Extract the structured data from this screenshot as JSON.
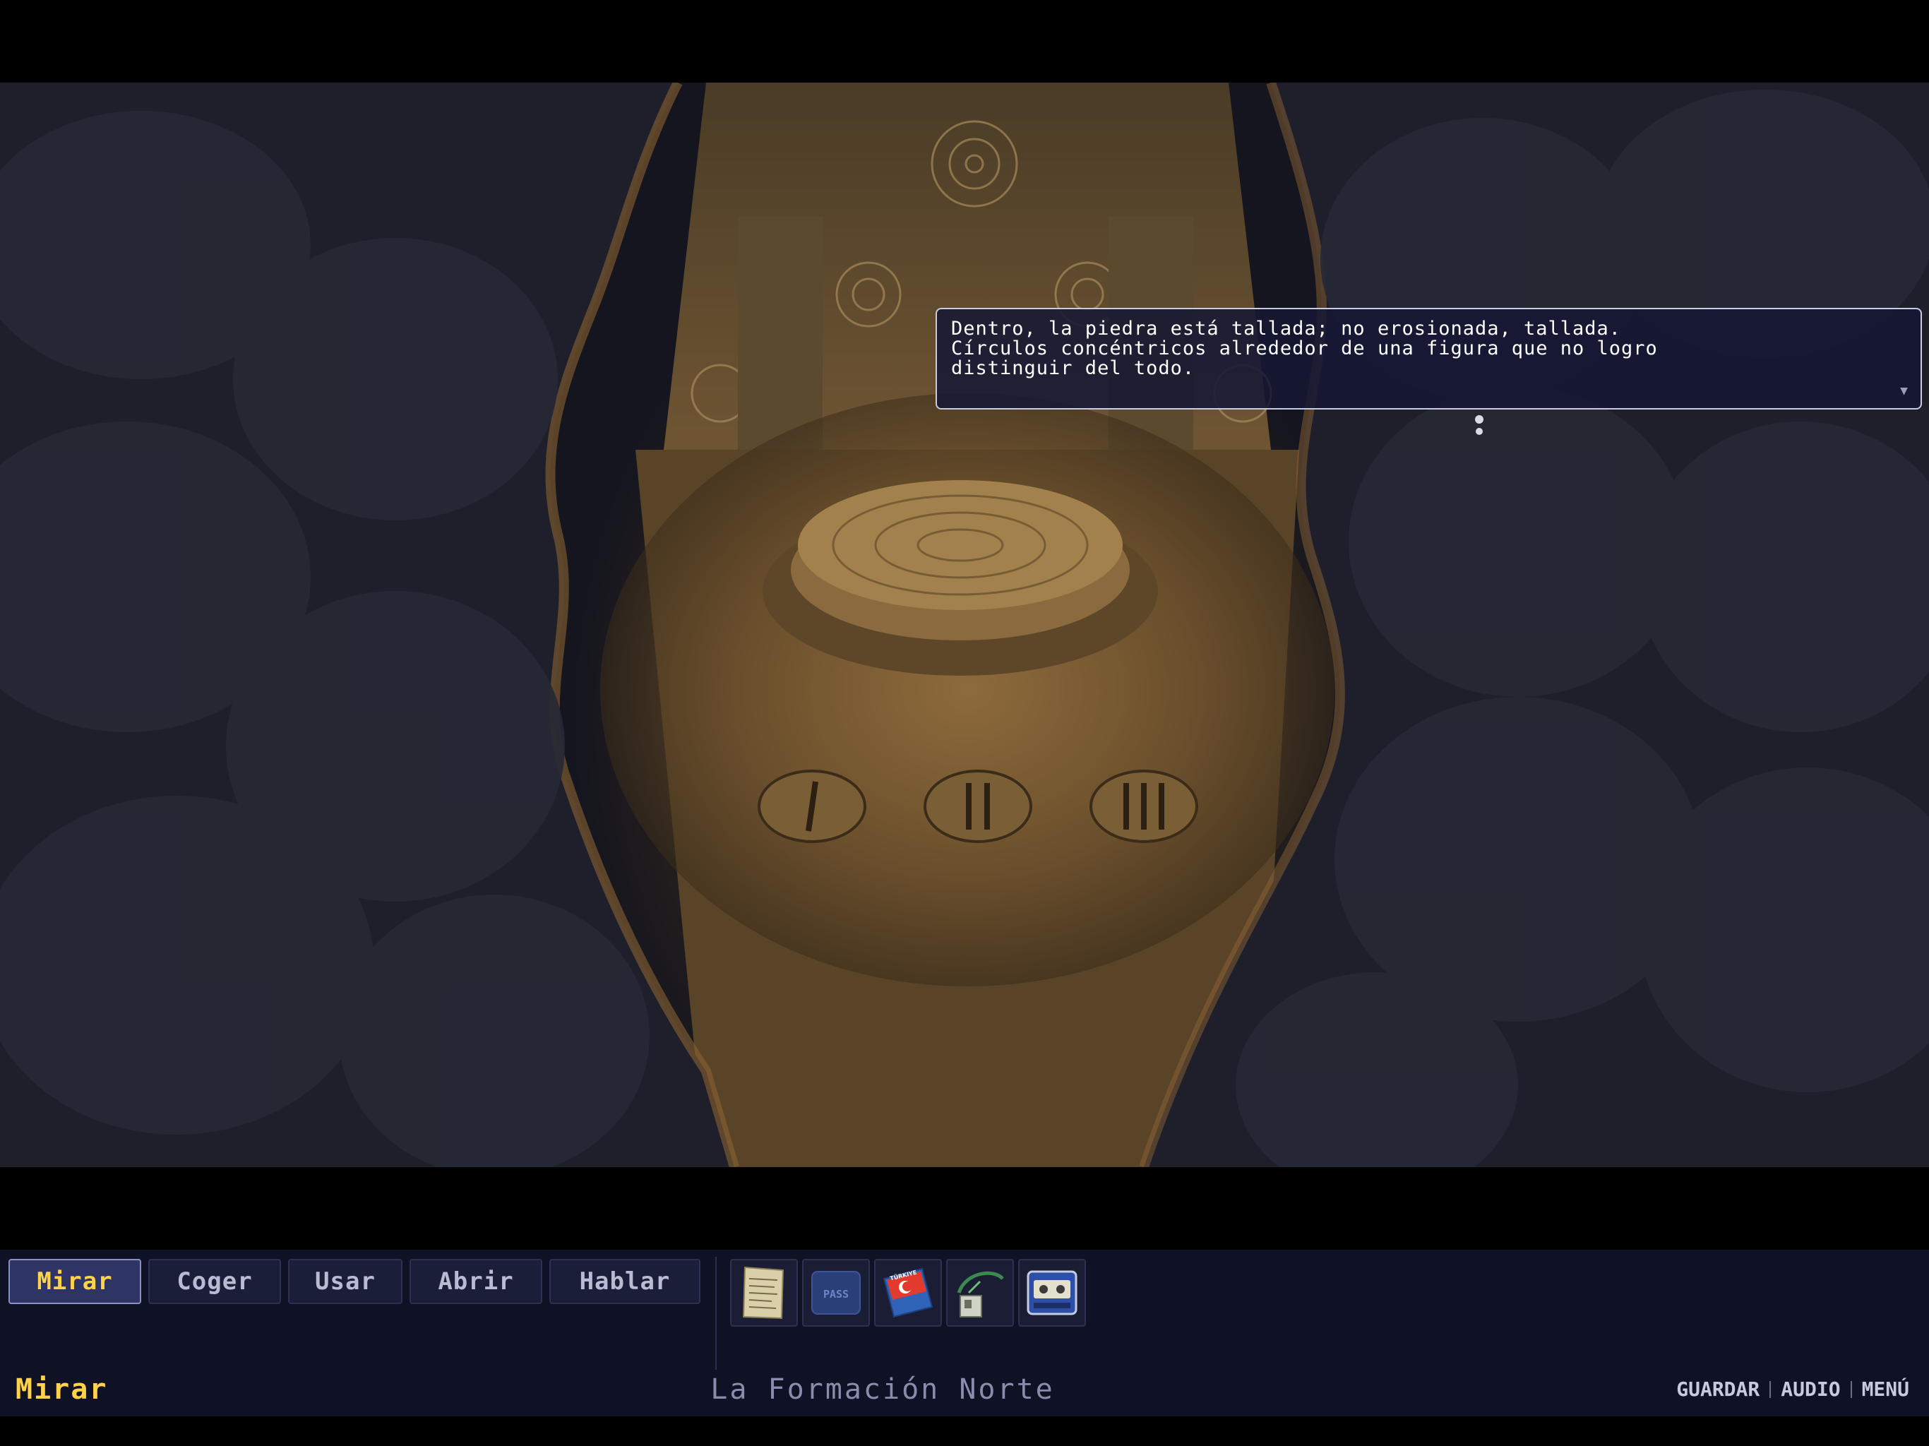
{
  "dialog": {
    "text": "Dentro, la piedra está tallada; no erosionada, tallada.\nCírculos concéntricos alrededor de una figura que no logro\ndistinguir del todo.",
    "continue_icon": "▼"
  },
  "verbs": [
    {
      "label": "Mirar",
      "active": true
    },
    {
      "label": "Coger",
      "active": false
    },
    {
      "label": "Usar",
      "active": false
    },
    {
      "label": "Abrir",
      "active": false
    },
    {
      "label": "Hablar",
      "active": false
    }
  ],
  "inventory": [
    {
      "icon": "note-paper-icon"
    },
    {
      "icon": "pass-card-icon",
      "label": "PASS"
    },
    {
      "icon": "turkey-book-icon",
      "label": "TÜRKIYE"
    },
    {
      "icon": "lanyard-badge-icon"
    },
    {
      "icon": "cassette-player-icon"
    }
  ],
  "status": {
    "current_verb": "Mirar",
    "location": "La Formación Norte"
  },
  "system_menu": {
    "save": "GUARDAR",
    "audio": "AUDIO",
    "menu": "MENÚ"
  },
  "colors": {
    "accent_yellow": "#ffd24a",
    "panel_bg": "#0f1124",
    "dialog_bg": "#161834"
  }
}
